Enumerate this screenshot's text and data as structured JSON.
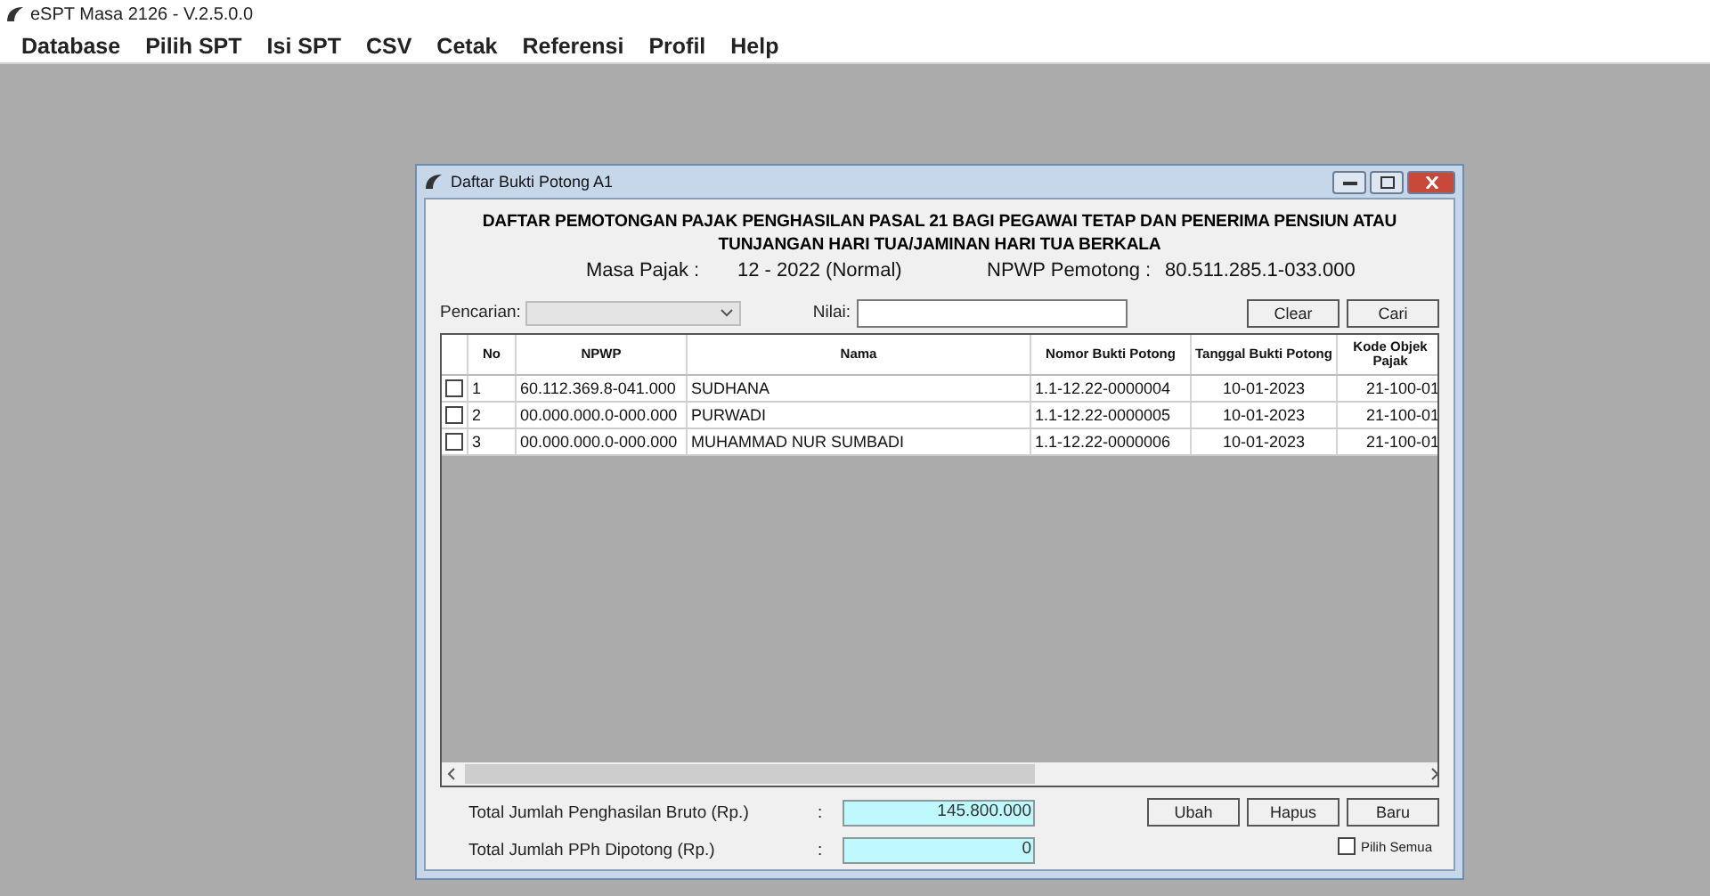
{
  "app": {
    "title": "eSPT Masa 2126 - V.2.5.0.0"
  },
  "menu": [
    "Database",
    "Pilih SPT",
    "Isi SPT",
    "CSV",
    "Cetak",
    "Referensi",
    "Profil",
    "Help"
  ],
  "dialog": {
    "title": "Daftar Bukti Potong A1",
    "heading": [
      "DAFTAR PEMOTONGAN PAJAK PENGHASILAN PASAL 21 BAGI PEGAWAI TETAP DAN PENERIMA PENSIUN ATAU",
      "TUNJANGAN HARI TUA/JAMINAN HARI TUA BERKALA"
    ],
    "masa_label": "Masa Pajak :",
    "masa_value": "12 - 2022 (Normal)",
    "npwp_label": "NPWP Pemotong :",
    "npwp_value": "80.511.285.1-033.000",
    "search": {
      "label": "Pencarian:",
      "value_label": "Nilai:",
      "buttons": [
        "Clear",
        "Cari"
      ]
    },
    "table": {
      "columns": [
        "No",
        "NPWP",
        "Nama",
        "Nomor Bukti Potong",
        "Tanggal Bukti Potong",
        "Kode Objek Pajak"
      ],
      "rows": [
        {
          "checked": false,
          "cells": [
            "1",
            "60.112.369.8-041.000",
            "SUDHANA",
            "1.1-12.22-0000004",
            "10-01-2023",
            "21-100-01"
          ]
        },
        {
          "checked": false,
          "cells": [
            "2",
            "00.000.000.0-000.000",
            "PURWADI",
            "1.1-12.22-0000005",
            "10-01-2023",
            "21-100-01"
          ]
        },
        {
          "checked": false,
          "cells": [
            "3",
            "00.000.000.0-000.000",
            "MUHAMMAD NUR SUMBADI",
            "1.1-12.22-0000006",
            "10-01-2023",
            "21-100-01"
          ]
        }
      ]
    },
    "totals": [
      {
        "label": "Total Jumlah Penghasilan Bruto (Rp.)",
        "colon": ":",
        "value": "145.800.000"
      },
      {
        "label": "Total Jumlah PPh Dipotong (Rp.)",
        "colon": ":",
        "value": "0"
      }
    ],
    "buttons": [
      "Ubah",
      "Hapus",
      "Baru"
    ],
    "select_all": {
      "label": "Pilih Semua",
      "checked": false
    }
  }
}
